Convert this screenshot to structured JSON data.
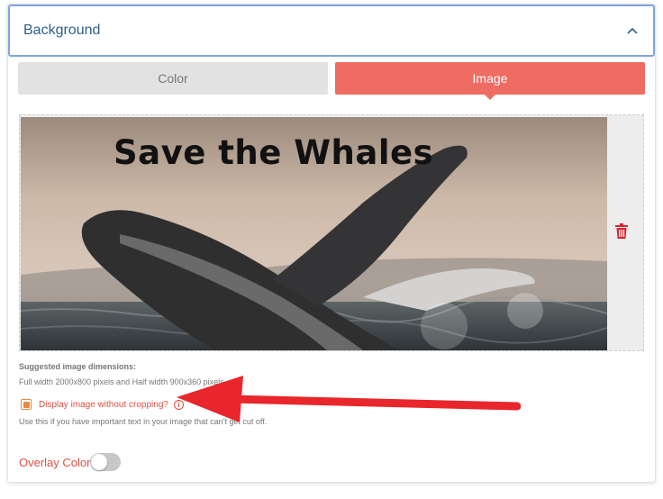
{
  "panel": {
    "title": "Background"
  },
  "tabs": [
    {
      "label": "Color",
      "active": false
    },
    {
      "label": "Image",
      "active": true
    }
  ],
  "image": {
    "caption": "Save the Whales"
  },
  "dimensions": {
    "title": "Suggested image dimensions:",
    "text": "Full width 2000x800 pixels and Half width 900x360 pixels."
  },
  "crop_option": {
    "label": "Display image without cropping?",
    "checked": true,
    "help": "Use this if you have important text in your image that can't get cut off."
  },
  "overlay": {
    "label": "Overlay Color",
    "enabled": false
  },
  "icons": {
    "collapse": "chevron-up-icon",
    "delete": "trash-icon",
    "info": "info-icon"
  },
  "colors": {
    "accent": "#ef6c63",
    "label_red": "#e34f3f",
    "header_border": "#7fa7e0",
    "checkbox": "#e7893e",
    "arrow": "#e8262b"
  }
}
